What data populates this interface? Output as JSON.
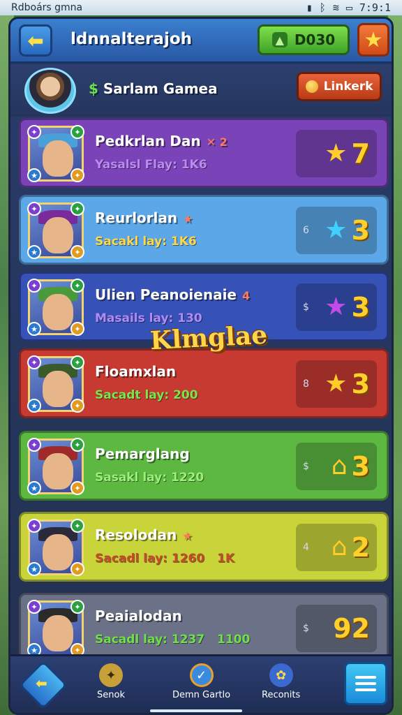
{
  "status_bar": {
    "left_text": "Rdboárs gmna",
    "time": "7:9:1"
  },
  "header": {
    "back_icon": "arrow-left-icon",
    "title": "ldnnalterajoh",
    "currency_value": "D030",
    "star_icon": "star-icon"
  },
  "profile": {
    "avatar_icon": "player-avatar",
    "name_prefix": "$",
    "name": "Sarlam Gamea",
    "link_button": "Linkerk"
  },
  "cards": [
    {
      "name": "Pedkrlan Dan",
      "mark": "✕ 2",
      "sub_text": "Yasalsl  Flay:",
      "sub_value": "1K6",
      "sub_extra": "",
      "score_prefix": "",
      "score_icon": "star-icon",
      "score_glyph": "★",
      "score": "7",
      "bg": "#7a44b8",
      "accent": "#b98af0",
      "glyph_color": "#ffcc2a"
    },
    {
      "name": "Reurlorlan",
      "mark": "★",
      "sub_text": "Sacakl  lay:",
      "sub_value": "1K6",
      "sub_extra": "",
      "score_prefix": "6",
      "score_icon": "star-icon",
      "score_glyph": "★",
      "score": "3",
      "bg": "#5ca7e8",
      "accent": "#ffd84a",
      "glyph_color": "#3fd0ff"
    },
    {
      "name": "Ulien Peanoienaie",
      "mark": "4",
      "sub_text": "Masails  lay:",
      "sub_value": "130",
      "sub_extra": "",
      "score_prefix": "$",
      "score_icon": "star-icon",
      "score_glyph": "★",
      "score": "3",
      "bg": "#3752b6",
      "accent": "#b08af8",
      "glyph_color": "#c24ae8"
    },
    {
      "name": "Floamxlan",
      "mark": "",
      "sub_text": "Sacadt  lay:",
      "sub_value": "200",
      "sub_extra": "",
      "score_prefix": "8",
      "score_icon": "star-icon",
      "score_glyph": "★",
      "score": "3",
      "bg": "#c63a32",
      "accent": "#76e84a",
      "glyph_color": "#ffcc2a"
    },
    {
      "name": "Pemarglang",
      "mark": "",
      "sub_text": "Sasakl  lay:",
      "sub_value": "1220",
      "sub_extra": "",
      "score_prefix": "$",
      "score_icon": "house-icon",
      "score_glyph": "⌂",
      "score": "3",
      "bg": "#5db842",
      "accent": "#9cf07a",
      "glyph_color": "#ffcc2a"
    },
    {
      "name": "Resolodan",
      "mark": "★",
      "sub_text": "Sacadl  lay:",
      "sub_value": "1260",
      "sub_extra": "1K",
      "score_prefix": "4",
      "score_icon": "house-icon",
      "score_glyph": "⌂",
      "score": "2",
      "bg": "#c8d43a",
      "accent": "#c84a2a",
      "glyph_color": "#ffcc2a"
    },
    {
      "name": "Peaialodan",
      "mark": "",
      "sub_text": "Sacadl  lay:",
      "sub_value": "1237",
      "sub_extra": "1100",
      "score_prefix": "$",
      "score_icon": "none",
      "score_glyph": "",
      "score": "92",
      "bg": "#6b7186",
      "accent": "#6ee04a",
      "glyph_color": "#ffcc2a"
    }
  ],
  "banner": "Klmglae",
  "bottom_nav": {
    "home_icon": "home-diamond-icon",
    "items": [
      {
        "label": "Senok",
        "icon": "leaf-icon",
        "glyph": "✦"
      },
      {
        "label": "Demn Gartlo",
        "icon": "checkmark-badge-icon",
        "glyph": "✓"
      },
      {
        "label": "Reconits",
        "icon": "flower-icon",
        "glyph": "✿"
      }
    ],
    "menu_icon": "hamburger-menu-icon"
  }
}
